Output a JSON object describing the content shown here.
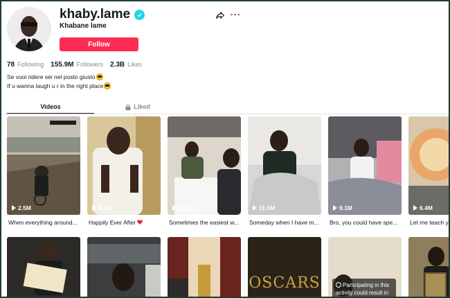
{
  "profile": {
    "username": "khaby.lame",
    "nickname": "Khabane lame",
    "follow_label": "Follow",
    "verified": true,
    "accent_color": "#fe2c55",
    "verified_color": "#20d5ec"
  },
  "stats": [
    {
      "value": "78",
      "label": "Following"
    },
    {
      "value": "155.9M",
      "label": "Followers"
    },
    {
      "value": "2.3B",
      "label": "Likes"
    }
  ],
  "bio": {
    "line1": "Se vuoi ridere sei nel posto giusto",
    "line2": "If u wanna laugh u r in the right place",
    "emoji": "sunglasses-emoji"
  },
  "tabs": {
    "videos": "Videos",
    "liked": "Liked"
  },
  "videos": [
    {
      "views": "2.5M",
      "caption": "When everything around..."
    },
    {
      "views": "4.1M",
      "caption": "Happily Ever After"
    },
    {
      "views": "16.1M",
      "caption": "Sometimes the easiest w..."
    },
    {
      "views": "11.5M",
      "caption": "Someday when I have m..."
    },
    {
      "views": "9.1M",
      "caption": "Bro, you could have spe..."
    },
    {
      "views": "6.4M",
      "caption": "Let me teach y..."
    }
  ],
  "videos_row2": {
    "oscars_text": "OSCARS",
    "notice_text": "Participating in this activity could result in"
  },
  "icons": {
    "share": "share-icon",
    "more": "more-icon",
    "lock": "lock-icon",
    "play": "play-icon",
    "heart": "heart-icon",
    "info": "info-icon"
  }
}
